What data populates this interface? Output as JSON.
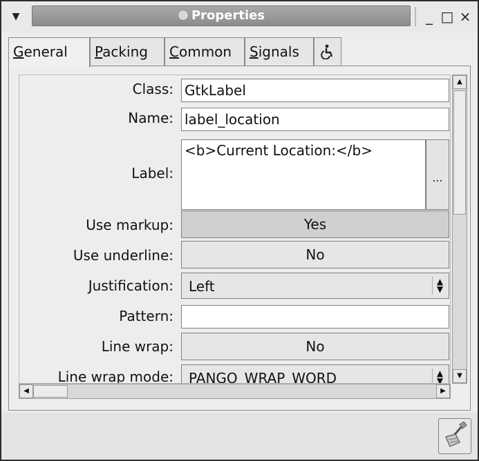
{
  "window": {
    "title": "Properties",
    "controls": {
      "minimize": "_",
      "maximize": "□",
      "close": "×"
    }
  },
  "tabs": [
    {
      "label": "General",
      "active": true
    },
    {
      "label": "Packing",
      "active": false
    },
    {
      "label": "Common",
      "active": false
    },
    {
      "label": "Signals",
      "active": false
    },
    {
      "label": "accessibility-icon",
      "active": false
    }
  ],
  "properties": {
    "class": {
      "label": "Class:",
      "value": "GtkLabel"
    },
    "name": {
      "label": "Name:",
      "value": "label_location"
    },
    "label": {
      "label": "Label:",
      "value": "<b>Current Location:</b>",
      "button": "..."
    },
    "use_markup": {
      "label": "Use markup:",
      "value": "Yes"
    },
    "use_underline": {
      "label": "Use underline:",
      "value": "No"
    },
    "justification": {
      "label": "Justification:",
      "value": "Left"
    },
    "pattern": {
      "label": "Pattern:",
      "value": ""
    },
    "line_wrap": {
      "label": "Line wrap:",
      "value": "No"
    },
    "line_wrap_mode": {
      "label": "Line wrap mode:",
      "value": "PANGO_WRAP_WORD"
    }
  },
  "icons": {
    "menu": "menu-arrow-icon",
    "scroll_up": "arrow-up-icon",
    "scroll_down": "arrow-down-icon",
    "scroll_left": "arrow-left-icon",
    "scroll_right": "arrow-right-icon",
    "clear": "broom-icon"
  }
}
